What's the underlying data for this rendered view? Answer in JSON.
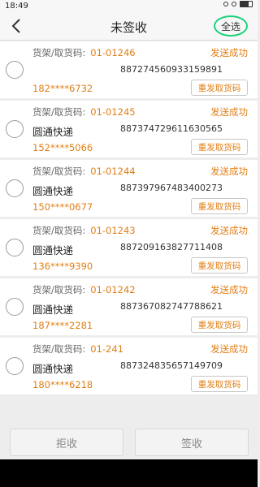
{
  "status_bar": {
    "time": "18:49"
  },
  "header": {
    "title": "未签收",
    "select_all": "全选"
  },
  "items": [
    {
      "shelf_label": "货架/取货码:",
      "shelf_code": "01-01246",
      "status": "发送成功",
      "carrier": "",
      "tracking": "887274560933159891",
      "phone": "182****6732",
      "resend": "重发取货码"
    },
    {
      "shelf_label": "货架/取货码:",
      "shelf_code": "01-01245",
      "status": "发送成功",
      "carrier": "圆通快递",
      "tracking": "887374729611630565",
      "phone": "152****5066",
      "resend": "重发取货码"
    },
    {
      "shelf_label": "货架/取货码:",
      "shelf_code": "01-01244",
      "status": "发送成功",
      "carrier": "圆通快递",
      "tracking": "887397967483400273",
      "phone": "150****0677",
      "resend": "重发取货码"
    },
    {
      "shelf_label": "货架/取货码:",
      "shelf_code": "01-01243",
      "status": "发送成功",
      "carrier": "圆通快递",
      "tracking": "887209163827711408",
      "phone": "136****9390",
      "resend": "重发取货码"
    },
    {
      "shelf_label": "货架/取货码:",
      "shelf_code": "01-01242",
      "status": "发送成功",
      "carrier": "圆通快递",
      "tracking": "887367082747788621",
      "phone": "187****2281",
      "resend": "重发取货码"
    },
    {
      "shelf_label": "货架/取货码:",
      "shelf_code": "01-241",
      "status": "发送成功",
      "carrier": "圆通快递",
      "tracking": "887324835657149709",
      "phone": "180****6218",
      "resend": "重发取货码"
    }
  ],
  "footer": {
    "reject": "拒收",
    "sign": "签收"
  },
  "colors": {
    "accent": "#e07f16",
    "highlight_circle": "#19d27a"
  }
}
